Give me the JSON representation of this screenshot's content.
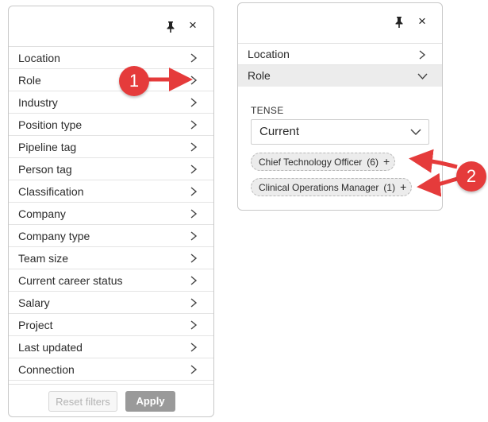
{
  "left_panel": {
    "items": [
      {
        "label": "Location"
      },
      {
        "label": "Role"
      },
      {
        "label": "Industry"
      },
      {
        "label": "Position type"
      },
      {
        "label": "Pipeline tag"
      },
      {
        "label": "Person tag"
      },
      {
        "label": "Classification"
      },
      {
        "label": "Company"
      },
      {
        "label": "Company type"
      },
      {
        "label": "Team size"
      },
      {
        "label": "Current career status"
      },
      {
        "label": "Salary"
      },
      {
        "label": "Project"
      },
      {
        "label": "Last updated"
      },
      {
        "label": "Connection"
      }
    ],
    "reset_label": "Reset filters",
    "apply_label": "Apply",
    "close_glyph": "×"
  },
  "right_panel": {
    "items": [
      {
        "label": "Location"
      },
      {
        "label": "Role"
      }
    ],
    "close_glyph": "×",
    "tense_label": "TENSE",
    "tense_value": "Current",
    "chips": [
      {
        "label": "Chief Technology Officer",
        "count": "(6)",
        "plus": "+"
      },
      {
        "label": "Clinical Operations Manager",
        "count": "(1)",
        "plus": "+"
      }
    ]
  },
  "callouts": [
    "1",
    "2"
  ],
  "colors": {
    "callout_red": "#e53b3b",
    "selected_row": "#ececec",
    "apply_btn": "#9a9a9a"
  },
  "icons": [
    "pin-icon",
    "close-icon",
    "chevron-right-icon",
    "chevron-down-icon",
    "plus-icon"
  ]
}
